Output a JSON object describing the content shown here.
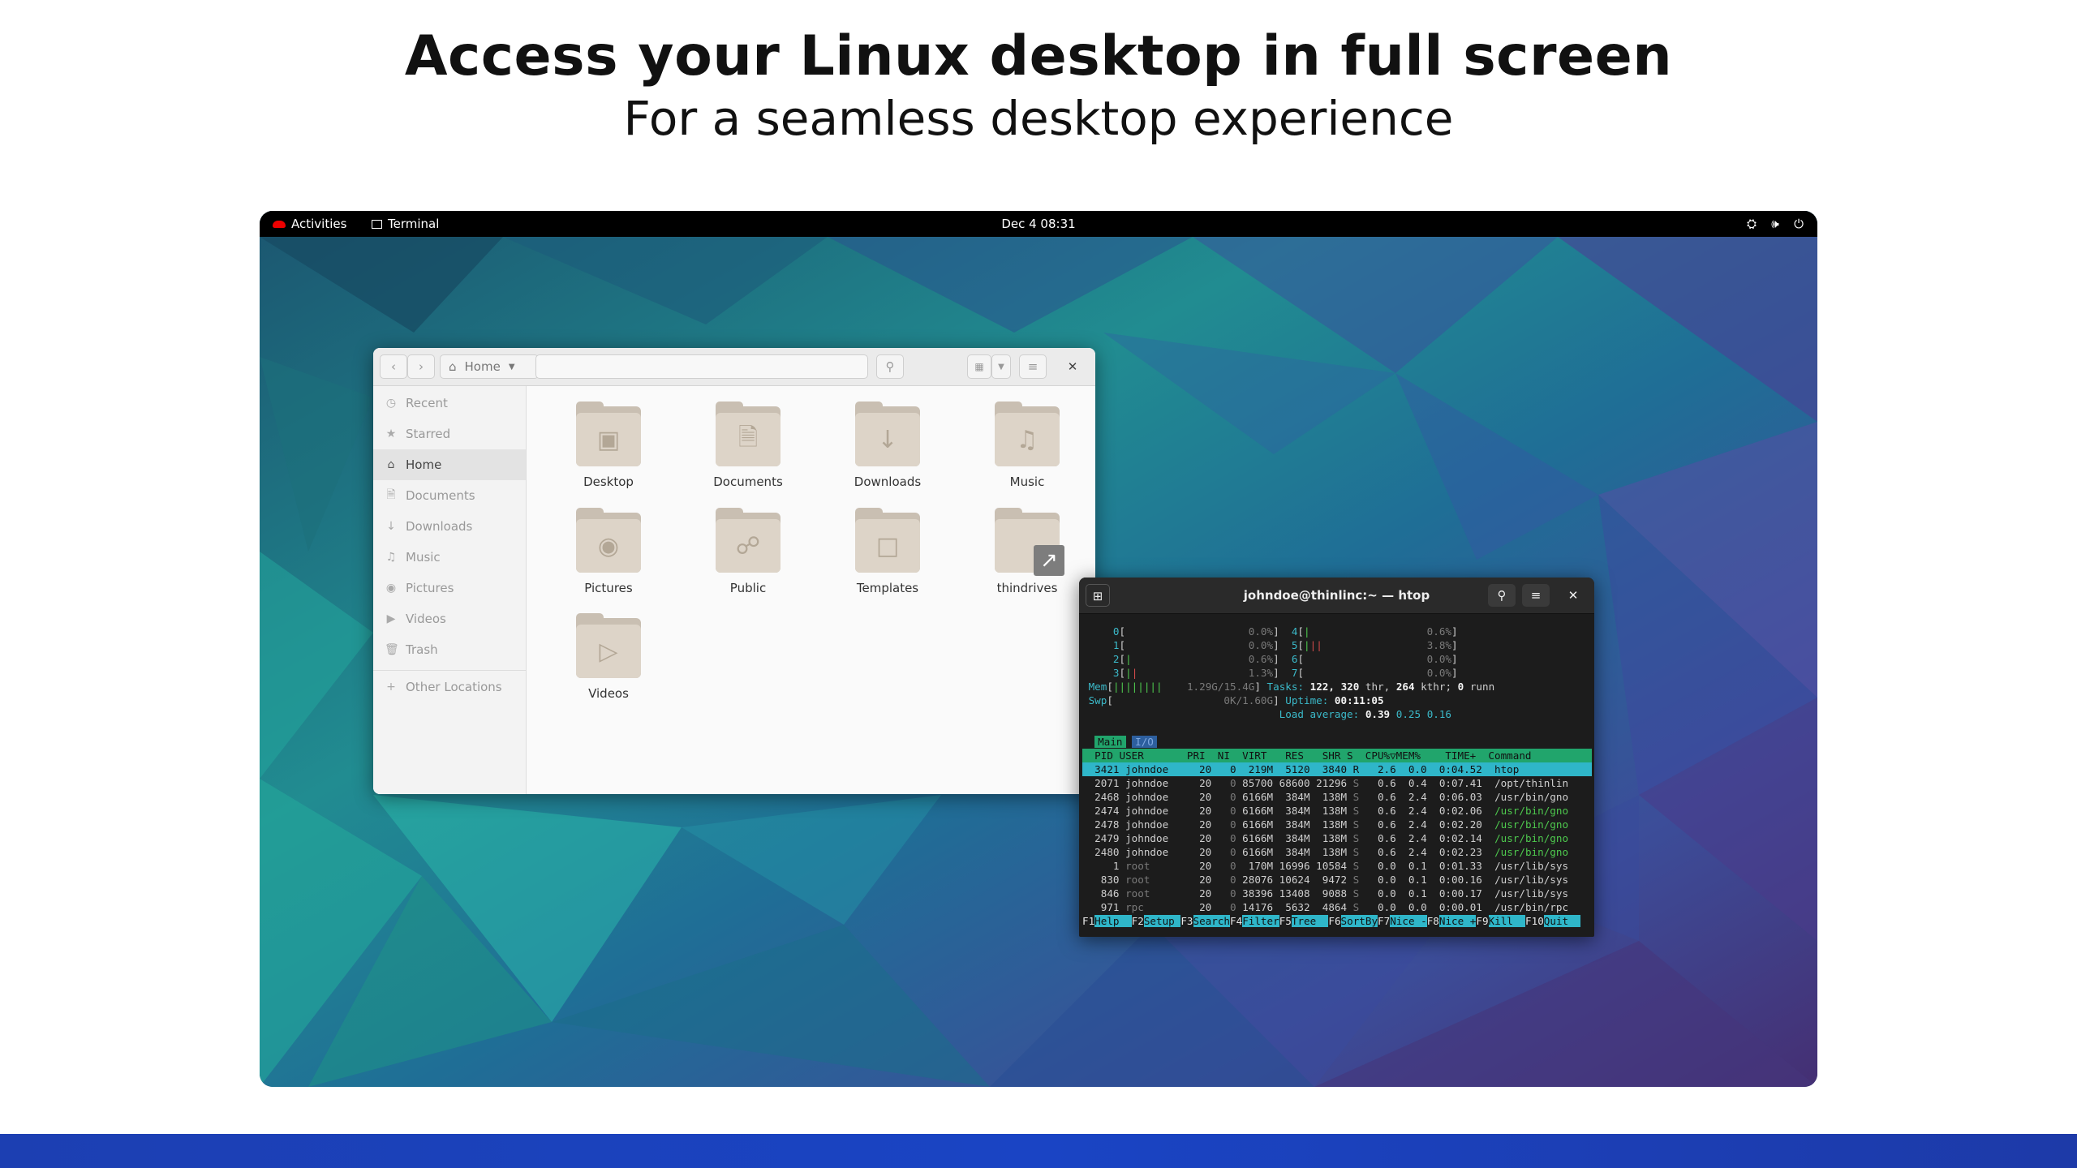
{
  "hero": {
    "title": "Access your Linux desktop in full screen",
    "subtitle": "For a seamless desktop experience"
  },
  "topbar": {
    "activities": "Activities",
    "app_name": "Terminal",
    "datetime": "Dec 4  08:31",
    "icons": [
      "network-icon",
      "volume-icon",
      "power-icon"
    ]
  },
  "files": {
    "location": "Home",
    "sidebar": [
      {
        "label": "Recent",
        "icon": "clock-icon"
      },
      {
        "label": "Starred",
        "icon": "star-icon"
      },
      {
        "label": "Home",
        "icon": "home-icon",
        "active": true
      },
      {
        "label": "Documents",
        "icon": "document-icon"
      },
      {
        "label": "Downloads",
        "icon": "download-icon"
      },
      {
        "label": "Music",
        "icon": "music-icon"
      },
      {
        "label": "Pictures",
        "icon": "camera-icon"
      },
      {
        "label": "Videos",
        "icon": "video-icon"
      },
      {
        "label": "Trash",
        "icon": "trash-icon"
      }
    ],
    "other_locations": "Other Locations",
    "folders": [
      {
        "label": "Desktop",
        "icon": "desktop-icon"
      },
      {
        "label": "Documents",
        "icon": "document-icon"
      },
      {
        "label": "Downloads",
        "icon": "download-icon"
      },
      {
        "label": "Music",
        "icon": "music-icon"
      },
      {
        "label": "Pictures",
        "icon": "camera-icon"
      },
      {
        "label": "Public",
        "icon": "share-icon"
      },
      {
        "label": "Templates",
        "icon": "template-icon"
      },
      {
        "label": "thindrives",
        "icon": "symlink-icon"
      },
      {
        "label": "Videos",
        "icon": "video-icon"
      }
    ]
  },
  "terminal": {
    "title": "johndoe@thinlinc:~ — htop",
    "cpus": [
      {
        "id": "0",
        "bar": "",
        "pct": "0.0%"
      },
      {
        "id": "1",
        "bar": "",
        "pct": "0.0%"
      },
      {
        "id": "2",
        "bar": "|",
        "pct": "0.6%"
      },
      {
        "id": "3",
        "bar": "||",
        "pct": "1.3%"
      },
      {
        "id": "4",
        "bar": "|",
        "pct": "0.6%"
      },
      {
        "id": "5",
        "bar": "|||",
        "pct": "3.8%"
      },
      {
        "id": "6",
        "bar": "",
        "pct": "0.0%"
      },
      {
        "id": "7",
        "bar": "",
        "pct": "0.0%"
      }
    ],
    "mem": {
      "label": "Mem",
      "bar": "||||||||",
      "value": "1.29G/15.4G"
    },
    "swp": {
      "label": "Swp",
      "bar": "",
      "value": "0K/1.60G"
    },
    "tasks": {
      "label": "Tasks:",
      "tasks": "122,",
      "thr": "320",
      "thr_label": "thr,",
      "kthr": "264",
      "kthr_label": "kthr;",
      "running": "0",
      "running_label": "runn"
    },
    "uptime": {
      "label": "Uptime:",
      "value": "00:11:05"
    },
    "load": {
      "label": "Load average:",
      "v1": "0.39",
      "v5": "0.25",
      "v15": "0.16"
    },
    "tabs": [
      "Main",
      "I/O"
    ],
    "columns": "  PID USER       PRI  NI  VIRT   RES   SHR S  CPU%▽MEM%    TIME+  Command",
    "processes": [
      {
        "pid": "3421",
        "user": "johndoe",
        "pri": "20",
        "ni": "0",
        "virt": "219M",
        "res": "5120",
        "shr": "3840",
        "s": "R",
        "cpu": "2.6",
        "mem": "0.0",
        "time": "0:04.52",
        "cmd": "htop",
        "selected": true
      },
      {
        "pid": "2071",
        "user": "johndoe",
        "pri": "20",
        "ni": "0",
        "virt": "85700",
        "res": "68600",
        "shr": "21296",
        "s": "S",
        "cpu": "0.6",
        "mem": "0.4",
        "time": "0:07.41",
        "cmd": "/opt/thinlin"
      },
      {
        "pid": "2468",
        "user": "johndoe",
        "pri": "20",
        "ni": "0",
        "virt": "6166M",
        "res": "384M",
        "shr": "138M",
        "s": "S",
        "cpu": "0.6",
        "mem": "2.4",
        "time": "0:06.03",
        "cmd": "/usr/bin/gno"
      },
      {
        "pid": "2474",
        "user": "johndoe",
        "pri": "20",
        "ni": "0",
        "virt": "6166M",
        "res": "384M",
        "shr": "138M",
        "s": "S",
        "cpu": "0.6",
        "mem": "2.4",
        "time": "0:02.06",
        "cmd": "/usr/bin/gno",
        "dim_cmd": true
      },
      {
        "pid": "2478",
        "user": "johndoe",
        "pri": "20",
        "ni": "0",
        "virt": "6166M",
        "res": "384M",
        "shr": "138M",
        "s": "S",
        "cpu": "0.6",
        "mem": "2.4",
        "time": "0:02.20",
        "cmd": "/usr/bin/gno",
        "dim_cmd": true
      },
      {
        "pid": "2479",
        "user": "johndoe",
        "pri": "20",
        "ni": "0",
        "virt": "6166M",
        "res": "384M",
        "shr": "138M",
        "s": "S",
        "cpu": "0.6",
        "mem": "2.4",
        "time": "0:02.14",
        "cmd": "/usr/bin/gno",
        "dim_cmd": true
      },
      {
        "pid": "2480",
        "user": "johndoe",
        "pri": "20",
        "ni": "0",
        "virt": "6166M",
        "res": "384M",
        "shr": "138M",
        "s": "S",
        "cpu": "0.6",
        "mem": "2.4",
        "time": "0:02.23",
        "cmd": "/usr/bin/gno",
        "dim_cmd": true
      },
      {
        "pid": "1",
        "user": "root",
        "pri": "20",
        "ni": "0",
        "virt": "170M",
        "res": "16996",
        "shr": "10584",
        "s": "S",
        "cpu": "0.0",
        "mem": "0.1",
        "time": "0:01.33",
        "cmd": "/usr/lib/sys"
      },
      {
        "pid": "830",
        "user": "root",
        "pri": "20",
        "ni": "0",
        "virt": "28076",
        "res": "10624",
        "shr": "9472",
        "s": "S",
        "cpu": "0.0",
        "mem": "0.1",
        "time": "0:00.16",
        "cmd": "/usr/lib/sys"
      },
      {
        "pid": "846",
        "user": "root",
        "pri": "20",
        "ni": "0",
        "virt": "38396",
        "res": "13408",
        "shr": "9088",
        "s": "S",
        "cpu": "0.0",
        "mem": "0.1",
        "time": "0:00.17",
        "cmd": "/usr/lib/sys"
      },
      {
        "pid": "971",
        "user": "rpc",
        "pri": "20",
        "ni": "0",
        "virt": "14176",
        "res": "5632",
        "shr": "4864",
        "s": "S",
        "cpu": "0.0",
        "mem": "0.0",
        "time": "0:00.01",
        "cmd": "/usr/bin/rpc"
      }
    ],
    "fkeys": [
      {
        "key": "F1",
        "label": "Help"
      },
      {
        "key": "F2",
        "label": "Setup"
      },
      {
        "key": "F3",
        "label": "Search"
      },
      {
        "key": "F4",
        "label": "Filter"
      },
      {
        "key": "F5",
        "label": "Tree"
      },
      {
        "key": "F6",
        "label": "SortBy"
      },
      {
        "key": "F7",
        "label": "Nice -"
      },
      {
        "key": "F8",
        "label": "Nice +"
      },
      {
        "key": "F9",
        "label": "Kill"
      },
      {
        "key": "F10",
        "label": "Quit"
      }
    ]
  }
}
